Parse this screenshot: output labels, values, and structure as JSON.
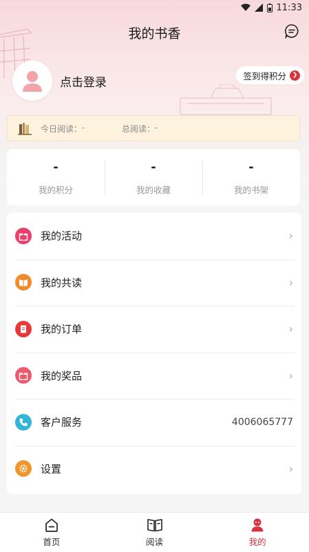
{
  "status_bar": {
    "time": "11:33"
  },
  "header": {
    "title": "我的书香"
  },
  "profile": {
    "login_text": "点击登录"
  },
  "signin": {
    "label": "签到得积分"
  },
  "reading": {
    "today_label": "今日阅读：",
    "today_value": "-",
    "total_label": "总阅读：",
    "total_value": "-"
  },
  "stats": [
    {
      "value": "-",
      "label": "我的积分"
    },
    {
      "value": "-",
      "label": "我的收藏"
    },
    {
      "value": "-",
      "label": "我的书架"
    }
  ],
  "menu": [
    {
      "label": "我的活动",
      "icon": "gift-icon",
      "color": "#e9406d"
    },
    {
      "label": "我的共读",
      "icon": "open-book-icon",
      "color": "#f08a2a"
    },
    {
      "label": "我的订单",
      "icon": "document-icon",
      "color": "#e63a3a"
    },
    {
      "label": "我的奖品",
      "icon": "gift-icon",
      "color": "#ec5a6d"
    },
    {
      "label": "客户服务",
      "icon": "phone-icon",
      "color": "#34b5d8",
      "value": "4006065777"
    },
    {
      "label": "设置",
      "icon": "settings-icon",
      "color": "#f0962a"
    }
  ],
  "tabbar": [
    {
      "label": "首页",
      "icon": "home-icon"
    },
    {
      "label": "阅读",
      "icon": "book-icon"
    },
    {
      "label": "我的",
      "icon": "profile-icon",
      "active": true
    }
  ],
  "colors": {
    "accent": "#d8343f",
    "reading_bar_bg": "#fdf2de",
    "header_pink": "#f7d9dd"
  }
}
